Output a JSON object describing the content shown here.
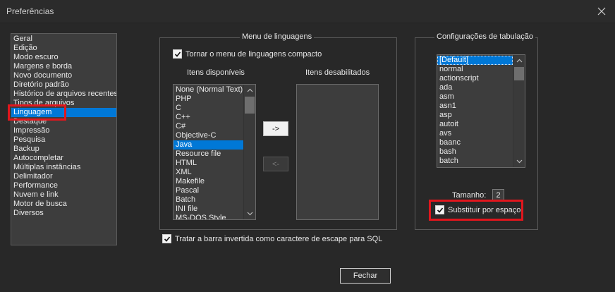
{
  "window": {
    "title": "Preferências",
    "close_icon": "close-icon"
  },
  "categories": [
    {
      "label": "Geral"
    },
    {
      "label": "Edição"
    },
    {
      "label": "Modo escuro"
    },
    {
      "label": "Margens e borda"
    },
    {
      "label": "Novo documento"
    },
    {
      "label": "Diretório padrão"
    },
    {
      "label": "Histórico de arquivos recentes"
    },
    {
      "label": "Tipos de arquivos"
    },
    {
      "label": "Linguagem",
      "selected": true
    },
    {
      "label": "Destaque"
    },
    {
      "label": "Impressão"
    },
    {
      "label": "Pesquisa"
    },
    {
      "label": "Backup"
    },
    {
      "label": "Autocompletar"
    },
    {
      "label": "Múltiplas instâncias"
    },
    {
      "label": "Delimitador"
    },
    {
      "label": "Performance"
    },
    {
      "label": "Nuvem e link"
    },
    {
      "label": "Motor de busca"
    },
    {
      "label": "Diversos"
    }
  ],
  "language_menu": {
    "legend": "Menu de linguagens",
    "compact_label": "Tornar o menu de linguagens compacto",
    "compact_checked": true,
    "available_label": "Itens disponíveis",
    "disabled_label": "Itens desabilitados",
    "available_items": [
      "None (Normal Text)",
      "PHP",
      "C",
      "C++",
      "C#",
      "Objective-C",
      "Java",
      "Resource file",
      "HTML",
      "XML",
      "Makefile",
      "Pascal",
      "Batch",
      "INI file",
      "MS-DOS Style"
    ],
    "available_selected": "Java",
    "move_right_label": "->",
    "move_left_label": "<-"
  },
  "sql_escape": {
    "label": "Tratar a barra invertida como caractere de escape para SQL",
    "checked": true
  },
  "tab_settings": {
    "legend": "Configurações de tabulação",
    "items": [
      "[Default]",
      "normal",
      "actionscript",
      "ada",
      "asm",
      "asn1",
      "asp",
      "autoit",
      "avs",
      "baanc",
      "bash",
      "batch"
    ],
    "selected": "[Default]",
    "size_label": "Tamanho:",
    "size_value": "2",
    "replace_label": "Substituir por espaço",
    "replace_checked": true
  },
  "footer": {
    "close_label": "Fechar"
  },
  "colors": {
    "selection": "#0078d7",
    "annotation": "#e0161d",
    "background": "#282828"
  }
}
